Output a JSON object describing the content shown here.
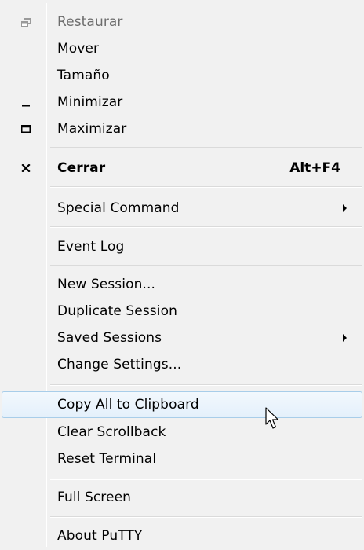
{
  "menu": {
    "items": [
      {
        "label": "Restaurar"
      },
      {
        "label": "Mover"
      },
      {
        "label": "Tamaño"
      },
      {
        "label": "Minimizar"
      },
      {
        "label": "Maximizar"
      },
      {
        "label": "Cerrar",
        "shortcut": "Alt+F4"
      },
      {
        "label": "Special Command"
      },
      {
        "label": "Event Log"
      },
      {
        "label": "New Session..."
      },
      {
        "label": "Duplicate Session"
      },
      {
        "label": "Saved Sessions"
      },
      {
        "label": "Change Settings..."
      },
      {
        "label": "Copy All to Clipboard"
      },
      {
        "label": "Clear Scrollback"
      },
      {
        "label": "Reset Terminal"
      },
      {
        "label": "Full Screen"
      },
      {
        "label": "About PuTTY"
      }
    ]
  },
  "icons": {
    "restore": "restore-icon",
    "minimize": "minimize-icon",
    "maximize": "maximize-icon",
    "close": "close-icon",
    "submenu": "submenu-arrow-icon",
    "cursor": "mouse-pointer-icon"
  },
  "colors": {
    "menu_background": "#f1f1f1",
    "highlight_border": "#a8cde9",
    "highlight_fill": "#e4f0fb",
    "disabled_text": "#6d6d6d"
  }
}
